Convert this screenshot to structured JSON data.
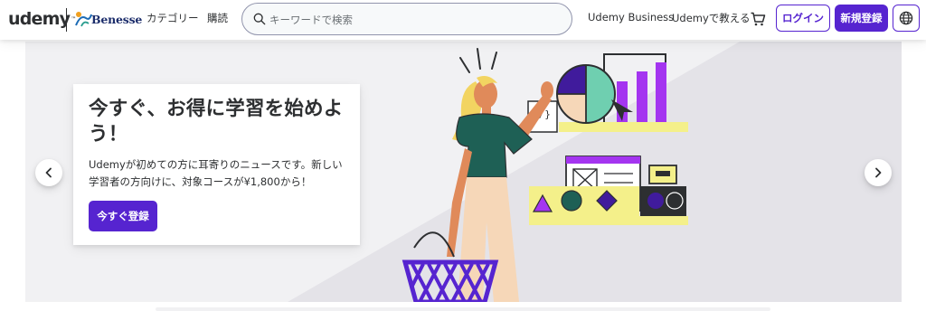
{
  "header": {
    "logo_text": "udemy",
    "logo_tm": "™",
    "partner_text": "Benesse",
    "categories_label": "カテゴリー",
    "purchase_label": "購読",
    "search_placeholder": "キーワードで検索",
    "business_label": "Udemy Business",
    "teach_label": "Udemyで教える",
    "login_label": "ログイン",
    "signup_label": "新規登録"
  },
  "hero": {
    "title": "今すぐ、お得に学習を始めよう！",
    "body": "Udemyが初めての方に耳寄りのニュースです。新しい学習者の方向けに、対象コースが¥1,800から！",
    "cta_label": "今すぐ登録"
  },
  "icons": {
    "search": "search-icon",
    "cart": "cart-icon",
    "language": "globe-icon",
    "prev": "chevron-left-icon",
    "next": "chevron-right-icon"
  },
  "colors": {
    "brand_purple": "#5624d0",
    "text_dark": "#2d2f31",
    "hero_bg": "#f1f1f3",
    "illustration_purple": "#a435f0",
    "illustration_teal": "#1e6055",
    "illustration_yellow": "#f4f08a",
    "illustration_mint": "#6fcfb0"
  }
}
